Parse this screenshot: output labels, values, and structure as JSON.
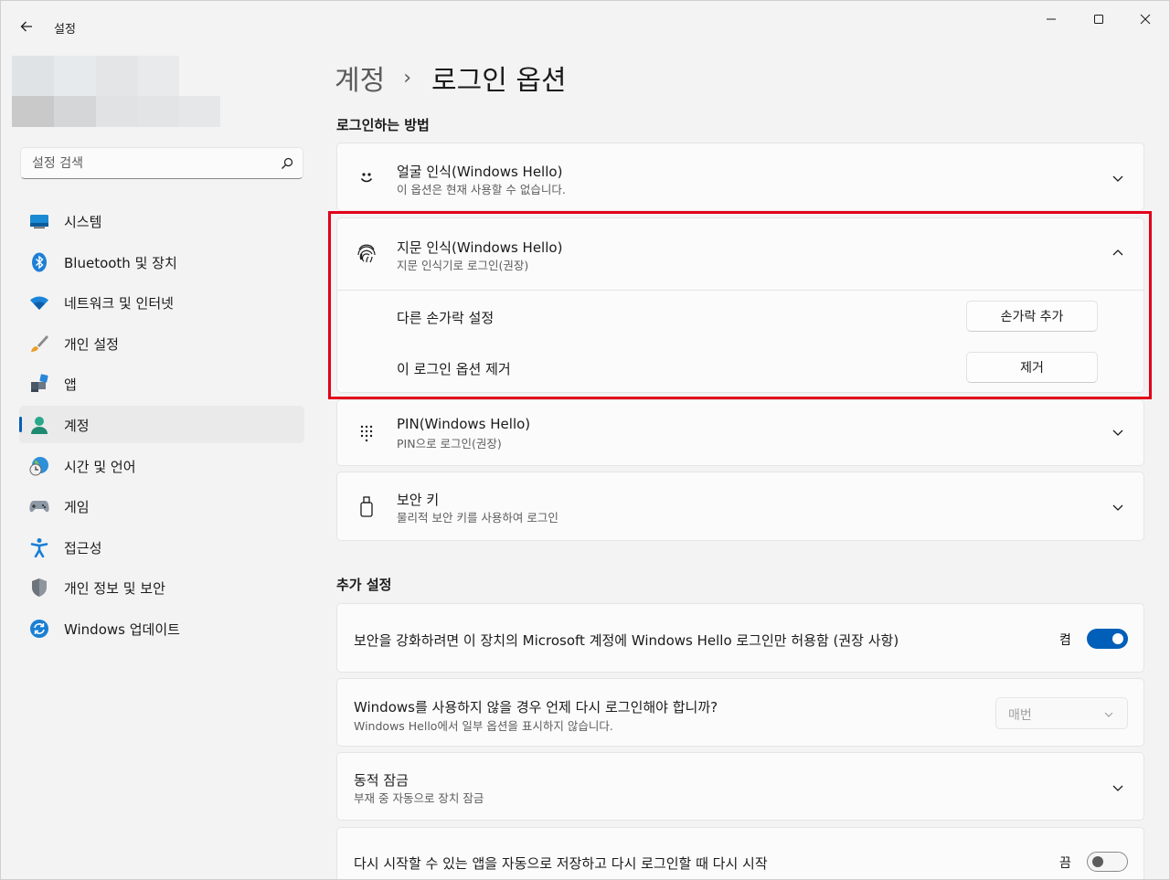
{
  "app": {
    "title": "설정"
  },
  "search": {
    "placeholder": "설정 검색"
  },
  "sidebar": {
    "items": [
      {
        "label": "시스템",
        "icon": "system-icon"
      },
      {
        "label": "Bluetooth 및 장치",
        "icon": "bluetooth-icon"
      },
      {
        "label": "네트워크 및 인터넷",
        "icon": "wifi-icon"
      },
      {
        "label": "개인 설정",
        "icon": "paintbrush-icon"
      },
      {
        "label": "앱",
        "icon": "apps-icon"
      },
      {
        "label": "계정",
        "icon": "account-icon",
        "active": true
      },
      {
        "label": "시간 및 언어",
        "icon": "time-language-icon"
      },
      {
        "label": "게임",
        "icon": "gamepad-icon"
      },
      {
        "label": "접근성",
        "icon": "accessibility-icon"
      },
      {
        "label": "개인 정보 및 보안",
        "icon": "shield-icon"
      },
      {
        "label": "Windows 업데이트",
        "icon": "update-icon"
      }
    ]
  },
  "breadcrumb": {
    "parent": "계정",
    "separator": "›",
    "current": "로그인 옵션"
  },
  "sections": {
    "signin_methods": "로그인하는 방법",
    "additional": "추가 설정"
  },
  "methods": {
    "face": {
      "title": "얼굴 인식(Windows Hello)",
      "subtitle": "이 옵션은 현재 사용할 수 없습니다."
    },
    "fingerprint": {
      "title": "지문 인식(Windows Hello)",
      "subtitle": "지문 인식기로 로그인(권장)",
      "row1_label": "다른 손가락 설정",
      "row1_button": "손가락 추가",
      "row2_label": "이 로그인 옵션 제거",
      "row2_button": "제거"
    },
    "pin": {
      "title": "PIN(Windows Hello)",
      "subtitle": "PIN으로 로그인(권장)"
    },
    "security_key": {
      "title": "보안 키",
      "subtitle": "물리적 보안 키를 사용하여 로그인"
    }
  },
  "additional": {
    "hello_only": {
      "label": "보안을 강화하려면 이 장치의 Microsoft 계정에 Windows Hello 로그인만 허용함 (권장 사항)",
      "state": "켬",
      "on": true
    },
    "relogin": {
      "title": "Windows를 사용하지 않을 경우 언제 다시 로그인해야 합니까?",
      "subtitle": "Windows Hello에서 일부 옵션을 표시하지 않습니다.",
      "value": "매번"
    },
    "dynamic_lock": {
      "title": "동적 잠금",
      "subtitle": "부재 중 자동으로 장치 잠금"
    },
    "restart_apps": {
      "label": "다시 시작할 수 있는 앱을 자동으로 저장하고 다시 로그인할 때 다시 시작",
      "state": "끔",
      "on": false
    }
  },
  "colors": {
    "accent": "#005fb8",
    "highlight_border": "#e2001a"
  }
}
